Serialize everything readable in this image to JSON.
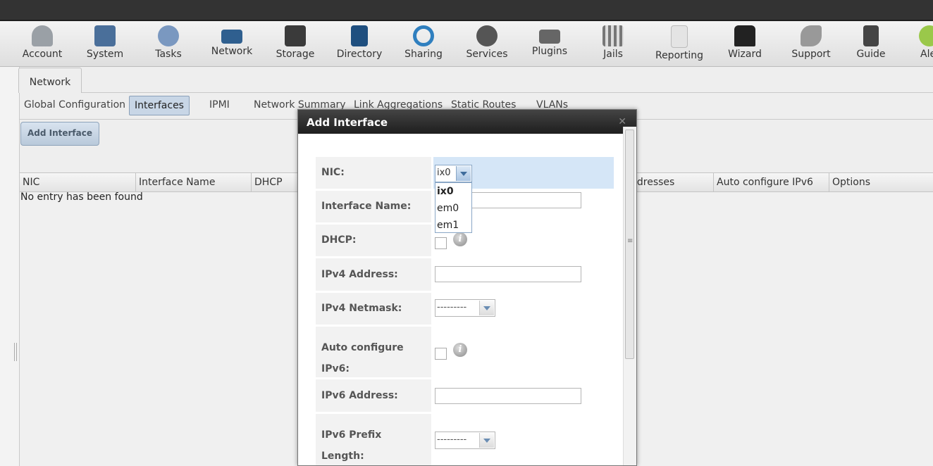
{
  "toolbar": {
    "items": [
      {
        "label": "Account",
        "icon": "account-icon",
        "color": "#8a8f96"
      },
      {
        "label": "System",
        "icon": "system-icon",
        "color": "#4a6f9a"
      },
      {
        "label": "Tasks",
        "icon": "tasks-icon",
        "color": "#7a98c0"
      },
      {
        "label": "Network",
        "icon": "network-icon",
        "color": "#2f5f8f"
      },
      {
        "label": "Storage",
        "icon": "storage-icon",
        "color": "#3a3a3a"
      },
      {
        "label": "Directory",
        "icon": "directory-icon",
        "color": "#1f4f7f"
      },
      {
        "label": "Sharing",
        "icon": "sharing-icon",
        "color": "#2f7fbf"
      },
      {
        "label": "Services",
        "icon": "services-icon",
        "color": "#555555"
      },
      {
        "label": "Plugins",
        "icon": "plugins-icon",
        "color": "#666666"
      },
      {
        "label": "Jails",
        "icon": "jails-icon",
        "color": "#777777"
      },
      {
        "label": "Reporting",
        "icon": "reporting-icon",
        "color": "#c9c9c9"
      },
      {
        "label": "Wizard",
        "icon": "wizard-icon",
        "color": "#222222"
      },
      {
        "label": "Support",
        "icon": "support-icon",
        "color": "#888888"
      },
      {
        "label": "Guide",
        "icon": "guide-icon",
        "color": "#444444"
      },
      {
        "label": "Ale",
        "icon": "alert-icon",
        "color": "#9ac84a"
      }
    ]
  },
  "main_tab": {
    "label": "Network"
  },
  "subtabs": [
    {
      "label": "Global Configuration"
    },
    {
      "label": "Interfaces",
      "active": true
    },
    {
      "label": "IPMI"
    },
    {
      "label": "Network Summary"
    },
    {
      "label": "Link Aggregations"
    },
    {
      "label": "Static Routes"
    },
    {
      "label": "VLANs"
    }
  ],
  "add_button": {
    "label": "Add Interface"
  },
  "grid": {
    "columns": [
      "NIC",
      "Interface Name",
      "DHCP",
      "",
      "ddresses",
      "Auto configure IPv6",
      "Options"
    ],
    "empty_message": "No entry has been found"
  },
  "dialog": {
    "title": "Add Interface",
    "close_icon": "close-icon",
    "fields": {
      "nic": {
        "label": "NIC:",
        "value": "ix0",
        "options": [
          "ix0",
          "em0",
          "em1"
        ]
      },
      "interface_name": {
        "label": "Interface Name:",
        "value": ""
      },
      "dhcp": {
        "label": "DHCP:",
        "checked": false
      },
      "ipv4_address": {
        "label": "IPv4 Address:",
        "value": ""
      },
      "ipv4_netmask": {
        "label": "IPv4 Netmask:",
        "value": "---------"
      },
      "auto_ipv6": {
        "label_line1": "Auto configure",
        "label_line2": "IPv6:",
        "checked": false
      },
      "ipv6_address": {
        "label": "IPv6 Address:",
        "value": ""
      },
      "ipv6_prefix": {
        "label_line1": "IPv6 Prefix",
        "label_line2": "Length:",
        "value": "---------"
      }
    },
    "info_glyph": "i"
  }
}
